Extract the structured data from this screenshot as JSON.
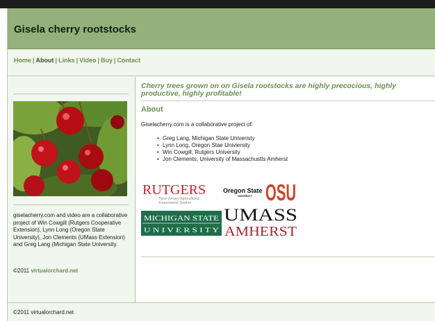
{
  "site": {
    "title": "Gisela cherry rootstocks"
  },
  "nav": {
    "items": [
      {
        "label": "Home",
        "active": false
      },
      {
        "label": "About",
        "active": true
      },
      {
        "label": "Links",
        "active": false
      },
      {
        "label": "Video",
        "active": false
      },
      {
        "label": "Buy",
        "active": false
      },
      {
        "label": "Contact",
        "active": false
      }
    ],
    "separator": "|"
  },
  "sidebar": {
    "photo_alt": "cherries-photo",
    "text": "giselacherry.com and video are a collaborative project of Win Cowgill (Rutgers Cooperative Extension), Lynn Long (Oregon State University), Jon Clements (UMass Extension) and Greg Lang (Michigan State University.",
    "copyright_prefix": "©2011 ",
    "copyright_link": "virtualorchard.net"
  },
  "main": {
    "tagline": "Cherry trees grown on on Gisela rootstocks are highly precocious, highly productive, highly profitable!",
    "heading": "About",
    "intro": "Giselacherry.com is a collaborative project of:",
    "people": [
      "Greg Lang, Michigan State Univeristy",
      "Lynn Long, Oregon Stae Univiersity",
      "Win Cowgill, Rutgers University",
      "Jon Clements, University of Massachustts Amherst"
    ],
    "logos": {
      "rutgers": {
        "name": "RUTGERS",
        "sub1": "New Jersey Agricultural",
        "sub2": "Experiment Station",
        "color": "#cc1f2f"
      },
      "oregon": {
        "name": "Oregon State",
        "sub": "UNIVERSITY",
        "mark": "OSU",
        "color": "#d2422a"
      },
      "michigan": {
        "line1": "MICHIGAN STATE",
        "line2": "U N I V E R S I T Y",
        "color": "#1e6e4a"
      },
      "umass": {
        "line1": "UMASS",
        "line2": "AMHERST",
        "color2": "#a32632"
      }
    }
  },
  "footer": {
    "text": "©2011 virtualorchard.net"
  }
}
